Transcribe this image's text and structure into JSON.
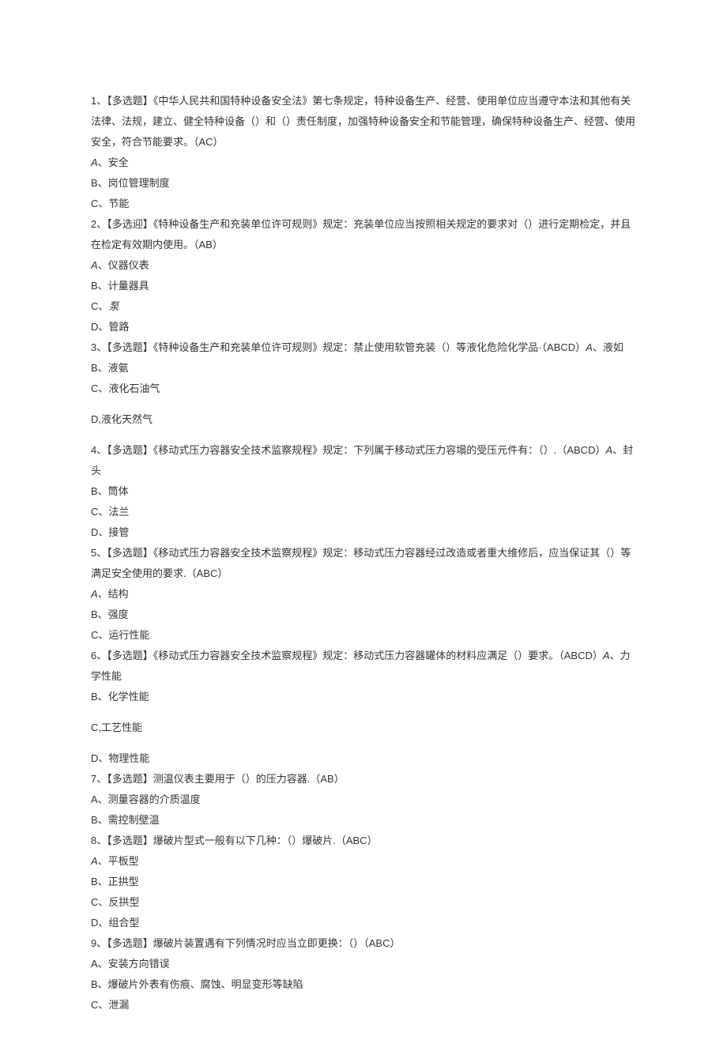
{
  "q1": {
    "line1": "1、【多选题】《中华人民共和国特种设备安全法》第七条规定，特种设备生产、经营、使用单位应当遵守本法和其他有关法律、法规，建立、健全特种设备（）和（）责任制度，加强特种设备安全和节能管理，确保特种设备生产、经营、使用安全，符合节能要求。（AC）",
    "optA_prefix": "A",
    "optA": "、安全",
    "optB": "B、岗位管理制度",
    "optC": "C、节能"
  },
  "q2": {
    "line1": "2、【多选迎】《特种设备生产和充装单位许可规则》规定：充装单位应当按照相关规定的要求对（）进行定期检定，并且在检定有效期内使用。（AB）",
    "optA_prefix": "A",
    "optA": "、仪器仪表",
    "optB": "B、计量器具",
    "optC_prefix": "C、",
    "optC": "泵",
    "optD": "D、管路"
  },
  "q3": {
    "line1_a": "3、【多选题】《特种设备生产和充装单位许可规则》规定：禁止使用软管充装（）等液化危险化学品·（ABCD）",
    "line1_b_prefix": "A",
    "line1_b": "、液如",
    "optB": "B、液氨",
    "optC": "C、液化石油气",
    "optD": "D,液化天然气"
  },
  "q4": {
    "line1_a": "4、【多选题】《移动式压力容器安全技术监察规程》规定：下列属于移动式压力容塌的受压元件有：（）.（ABCD）",
    "line1_b_prefix": "A",
    "line1_b": "、封头",
    "optB": "B、筒体",
    "optC": "C、法兰",
    "optD": "D、接管"
  },
  "q5": {
    "line1": "5、【多选题】《移动式压力容器安全技术监察规程》规定：移动式压力容器经过改造或者重大维修后，应当保证其（）等满足安全使用的要求.（ABC）",
    "optA_prefix": "A",
    "optA": "、结构",
    "optB": "B、强度",
    "optC": "C、运行性能"
  },
  "q6": {
    "line1_a": "6、【多选题】《移动式压力容器安全技术监察规程》规定：移动式压力容器罐体的材料应满足（）要求。（ABCD）",
    "line1_b_prefix": "A",
    "line1_b": "、力学性能",
    "optB": "B、化学性能",
    "optC": "C,工艺性能",
    "optD": "D、物理性能"
  },
  "q7": {
    "line1": "7、【多选题】测温仪表主要用于（）的压力容器.（AB）",
    "optA": "A、测量容器的介质温度",
    "optB": "B、需控制壁温"
  },
  "q8": {
    "line1": "8、【多选题】爆破片型式一般有以下几种：（）爆破片.（ABC）",
    "optA_prefix": "A",
    "optA": "、平板型",
    "optB": "B、正拱型",
    "optC": "C、反拱型",
    "optD": "D、组合型"
  },
  "q9": {
    "line1": "9、【多选题】爆破片装置遇有下列情况时应当立即更换：（）（ABC）",
    "optA": "A、安装方向错误",
    "optB": "B、爆破片外表有伤痕、腐蚀、明显变形等缺陷",
    "optC": "C、泄漏"
  }
}
